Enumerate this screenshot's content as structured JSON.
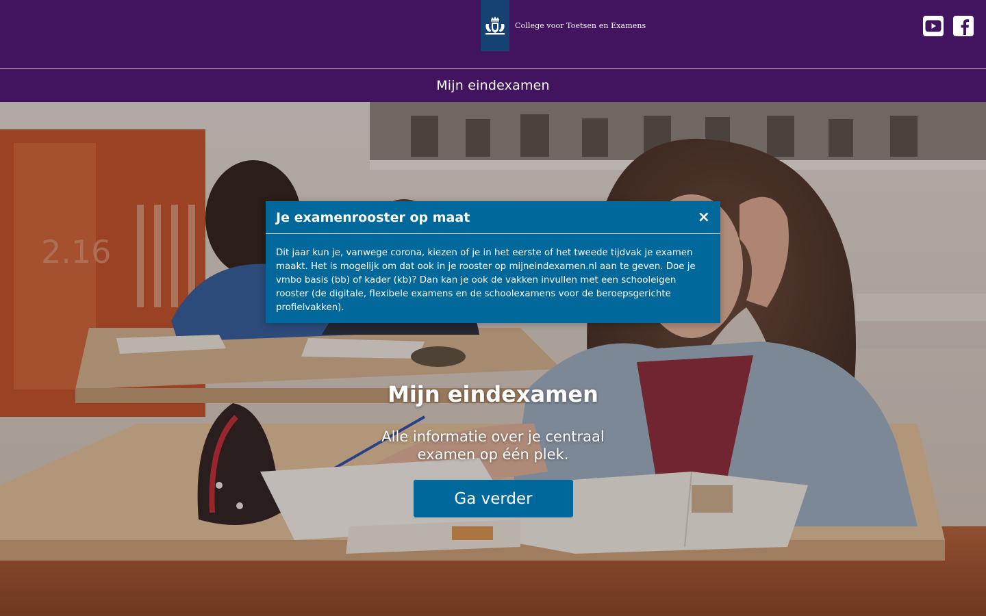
{
  "header": {
    "org_name": "College voor Toetsen en Examens",
    "social": [
      {
        "icon": "youtube-icon"
      },
      {
        "icon": "facebook-icon"
      }
    ]
  },
  "nav": {
    "title": "Mijn eindexamen"
  },
  "hero": {
    "title": "Mijn eindexamen",
    "subtitle": "Alle informatie over je centraal examen op één plek.",
    "cta_label": "Ga verder"
  },
  "modal": {
    "title": "Je examenrooster op maat",
    "close_symbol": "×",
    "body": "Dit jaar kun je, vanwege corona, kiezen of je in het eerste of het tweede tijdvak je examen maakt. Het is mogelijk om dat ook in je rooster op mijneindexamen.nl aan te geven. Doe je vmbo basis (bb) of kader (kb)? Dan kan je ook de vakken invullen met een schooleigen rooster (de digitale, flexibele examens en de schoolexamens voor de beroepsgerichte profielvakken)."
  },
  "colors": {
    "header_purple": "#42145f",
    "logo_blue": "#154273",
    "primary_blue": "#01689b"
  }
}
